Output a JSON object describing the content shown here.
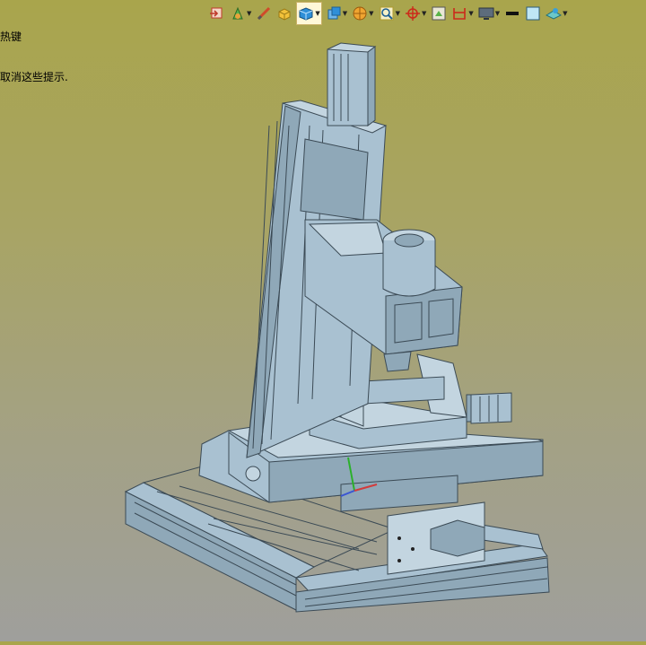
{
  "hint": {
    "line1": "热键",
    "line2": "取消这些提示."
  },
  "toolbar": {
    "buttons": [
      {
        "name": "exit-sketch-icon",
        "dropdown": false
      },
      {
        "name": "display-style-icon",
        "dropdown": true
      },
      {
        "name": "smart-dimension-icon",
        "dropdown": false
      },
      {
        "name": "insert-part-icon",
        "dropdown": false
      },
      {
        "name": "view-cube-icon",
        "dropdown": true,
        "active": true
      },
      {
        "name": "view-orientation-icon",
        "dropdown": true
      },
      {
        "name": "appearance-ball-icon",
        "dropdown": true
      },
      {
        "name": "zoom-area-icon",
        "dropdown": true
      },
      {
        "name": "rotate-view-icon",
        "dropdown": true
      },
      {
        "name": "section-view-icon",
        "dropdown": false
      },
      {
        "name": "hide-show-items-icon",
        "dropdown": true
      },
      {
        "name": "monitor-display-icon",
        "dropdown": true
      },
      {
        "name": "line-thickness-icon",
        "dropdown": false
      },
      {
        "name": "background-icon",
        "dropdown": false
      },
      {
        "name": "scene-icon",
        "dropdown": true
      }
    ]
  },
  "colors": {
    "background_top": "#a9a54c",
    "background_bottom": "#9f9f9c",
    "model_face": "#a9c1d1",
    "model_edge": "#3b4a55"
  }
}
